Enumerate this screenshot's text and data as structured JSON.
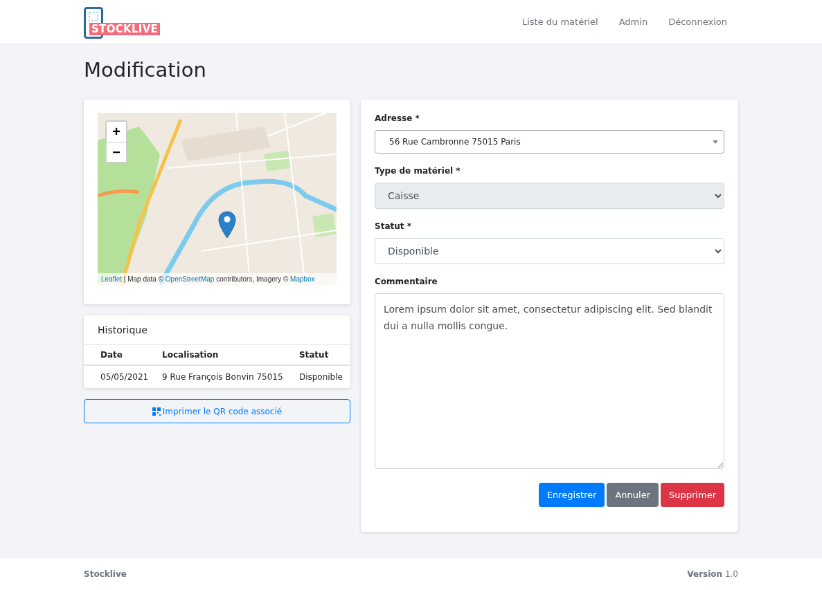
{
  "navbar": {
    "logo": "STOCKLIVE",
    "links": [
      "Liste du matériel",
      "Admin",
      "Déconnexion"
    ]
  },
  "page_title": "Modification",
  "map": {
    "zoom_in": "+",
    "zoom_out": "−",
    "attribution": [
      {
        "text": "Leaflet",
        "kind": "link"
      },
      {
        "text": " | Map data © ",
        "kind": "text"
      },
      {
        "text": "OpenStreetMap",
        "kind": "link"
      },
      {
        "text": " contributors, Imagery © ",
        "kind": "text"
      },
      {
        "text": "Mapbox",
        "kind": "link"
      }
    ]
  },
  "history": {
    "title": "Historique",
    "columns": [
      "Date",
      "Localisation",
      "Statut"
    ],
    "rows": [
      [
        "05/05/2021",
        "9 Rue François Bonvin 75015",
        "Disponible"
      ]
    ]
  },
  "qr_button": "Imprimer le QR code associé",
  "form": {
    "fields": [
      {
        "label": "Adresse *",
        "kind": "select2",
        "value": "56 Rue Cambronne 75015 Paris",
        "disabled": false
      },
      {
        "label": "Type de matériel *",
        "kind": "select",
        "value": "Caisse",
        "disabled": true
      },
      {
        "label": "Statut *",
        "kind": "select",
        "value": "Disponible",
        "disabled": false
      },
      {
        "label": "Commentaire",
        "kind": "textarea",
        "value": "Lorem ipsum dolor sit amet, consectetur adipiscing elit. Sed blandit dui a nulla mollis congue.",
        "disabled": false
      }
    ],
    "buttons": [
      {
        "label": "Enregistrer",
        "kind": "primary"
      },
      {
        "label": "Annuler",
        "kind": "secondary"
      },
      {
        "label": "Supprimer",
        "kind": "danger"
      }
    ]
  },
  "footer": {
    "brand": "Stocklive",
    "version": "**Version** 1.0"
  }
}
